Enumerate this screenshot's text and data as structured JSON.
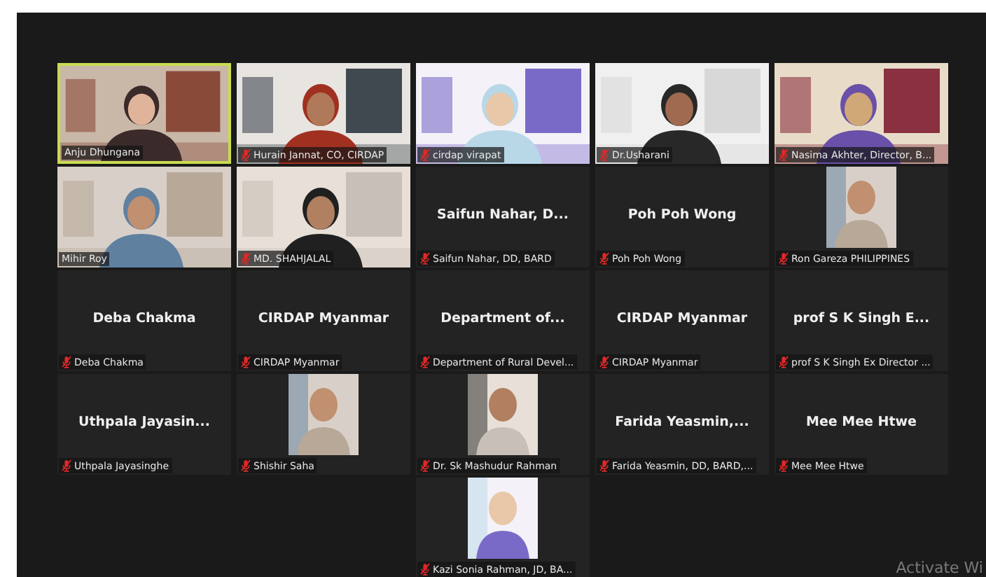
{
  "tiles": [
    {
      "kind": "video",
      "label": "Anju Dhungana",
      "muted": false,
      "selected": true
    },
    {
      "kind": "video",
      "label": "Hurain Jannat, CO, CIRDAP",
      "muted": true,
      "selected": false
    },
    {
      "kind": "video",
      "label": "cirdap virapat",
      "muted": true,
      "selected": false
    },
    {
      "kind": "video",
      "label": "Dr.Usharani",
      "muted": true,
      "selected": false
    },
    {
      "kind": "video",
      "label": "Nasima Akhter, Director, B...",
      "muted": true,
      "selected": false
    },
    {
      "kind": "video",
      "label": "Mihir Roy",
      "muted": false,
      "selected": false
    },
    {
      "kind": "video",
      "label": "MD. SHAHJALAL",
      "muted": true,
      "selected": false
    },
    {
      "kind": "name",
      "name": "Saifun Nahar, D...",
      "label": "Saifun Nahar, DD, BARD",
      "muted": true,
      "selected": false
    },
    {
      "kind": "name",
      "name": "Poh Poh Wong",
      "label": "Poh Poh Wong",
      "muted": true,
      "selected": false
    },
    {
      "kind": "avatar",
      "label": "Ron Gareza PHILIPPINES",
      "muted": true,
      "selected": false
    },
    {
      "kind": "name",
      "name": "Deba Chakma",
      "label": "Deba Chakma",
      "muted": true,
      "selected": false
    },
    {
      "kind": "name",
      "name": "CIRDAP Myanmar",
      "label": "CIRDAP Myanmar",
      "muted": true,
      "selected": false
    },
    {
      "kind": "name",
      "name": "Department of...",
      "label": "Department of Rural Devel...",
      "muted": true,
      "selected": false
    },
    {
      "kind": "name",
      "name": "CIRDAP Myanmar",
      "label": "CIRDAP Myanmar",
      "muted": true,
      "selected": false
    },
    {
      "kind": "name",
      "name": "prof S K Singh E...",
      "label": "prof S K Singh Ex Director ...",
      "muted": true,
      "selected": false
    },
    {
      "kind": "name",
      "name": "Uthpala Jayasin...",
      "label": "Uthpala Jayasinghe",
      "muted": true,
      "selected": false
    },
    {
      "kind": "avatar",
      "label": "Shishir Saha",
      "muted": true,
      "selected": false
    },
    {
      "kind": "avatar",
      "label": "Dr. Sk Mashudur Rahman",
      "muted": true,
      "selected": false
    },
    {
      "kind": "name",
      "name": "Farida Yeasmin,...",
      "label": "Farida Yeasmin, DD, BARD,...",
      "muted": true,
      "selected": false
    },
    {
      "kind": "name",
      "name": "Mee Mee Htwe",
      "label": "Mee Mee Htwe",
      "muted": true,
      "selected": false
    },
    {
      "kind": "avatar",
      "label": "Kazi Sonia Rahman, JD, BA...",
      "muted": true,
      "selected": false
    }
  ],
  "os_notice": "Activate Wi"
}
